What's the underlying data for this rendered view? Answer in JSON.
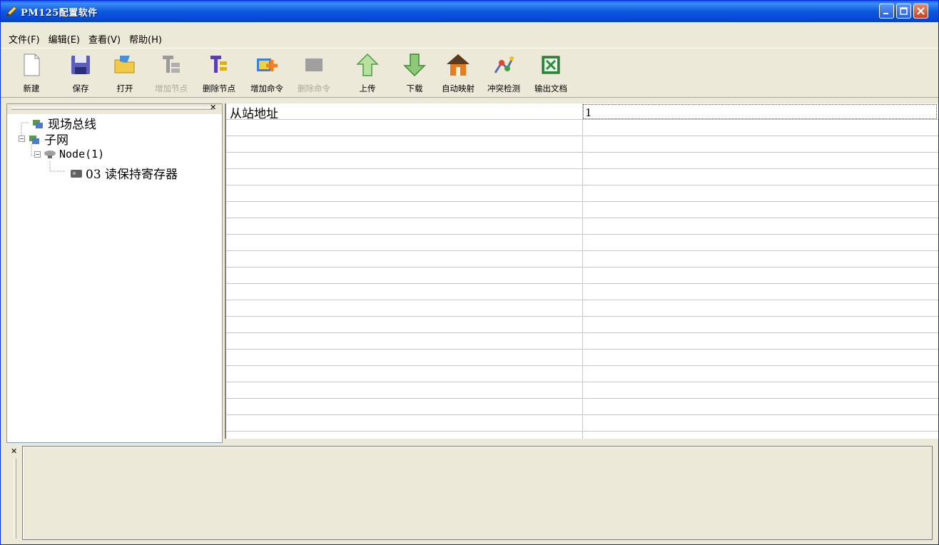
{
  "window": {
    "title": "PM125配置软件"
  },
  "menu": [
    {
      "label": "文件(F)"
    },
    {
      "label": "编辑(E)"
    },
    {
      "label": "查看(V)"
    },
    {
      "label": "帮助(H)"
    }
  ],
  "toolbar": [
    {
      "label": "新建",
      "icon": "new-file-icon",
      "enabled": true
    },
    {
      "label": "保存",
      "icon": "save-icon",
      "enabled": true
    },
    {
      "label": "打开",
      "icon": "open-folder-icon",
      "enabled": true
    },
    {
      "label": "增加节点",
      "icon": "add-node-icon",
      "enabled": false
    },
    {
      "label": "删除节点",
      "icon": "delete-node-icon",
      "enabled": true
    },
    {
      "label": "增加命令",
      "icon": "add-command-icon",
      "enabled": true
    },
    {
      "label": "删除命令",
      "icon": "delete-command-icon",
      "enabled": false
    },
    {
      "label": "上传",
      "icon": "upload-arrow-icon",
      "enabled": true
    },
    {
      "label": "下载",
      "icon": "download-arrow-icon",
      "enabled": true
    },
    {
      "label": "自动映射",
      "icon": "auto-map-icon",
      "enabled": true
    },
    {
      "label": "冲突检测",
      "icon": "conflict-detect-icon",
      "enabled": true
    },
    {
      "label": "输出文档",
      "icon": "excel-export-icon",
      "enabled": true
    }
  ],
  "tree": {
    "root": "现场总线",
    "subnet": "子网",
    "node": "Node(1)",
    "command": "03 读保持寄存器"
  },
  "properties": {
    "rows": [
      {
        "name": "从站地址",
        "value": "1"
      }
    ]
  },
  "colors": {
    "titlebar": "#0b59e0",
    "window_bg": "#ece9d8",
    "grid_line": "#c8c8c8"
  }
}
